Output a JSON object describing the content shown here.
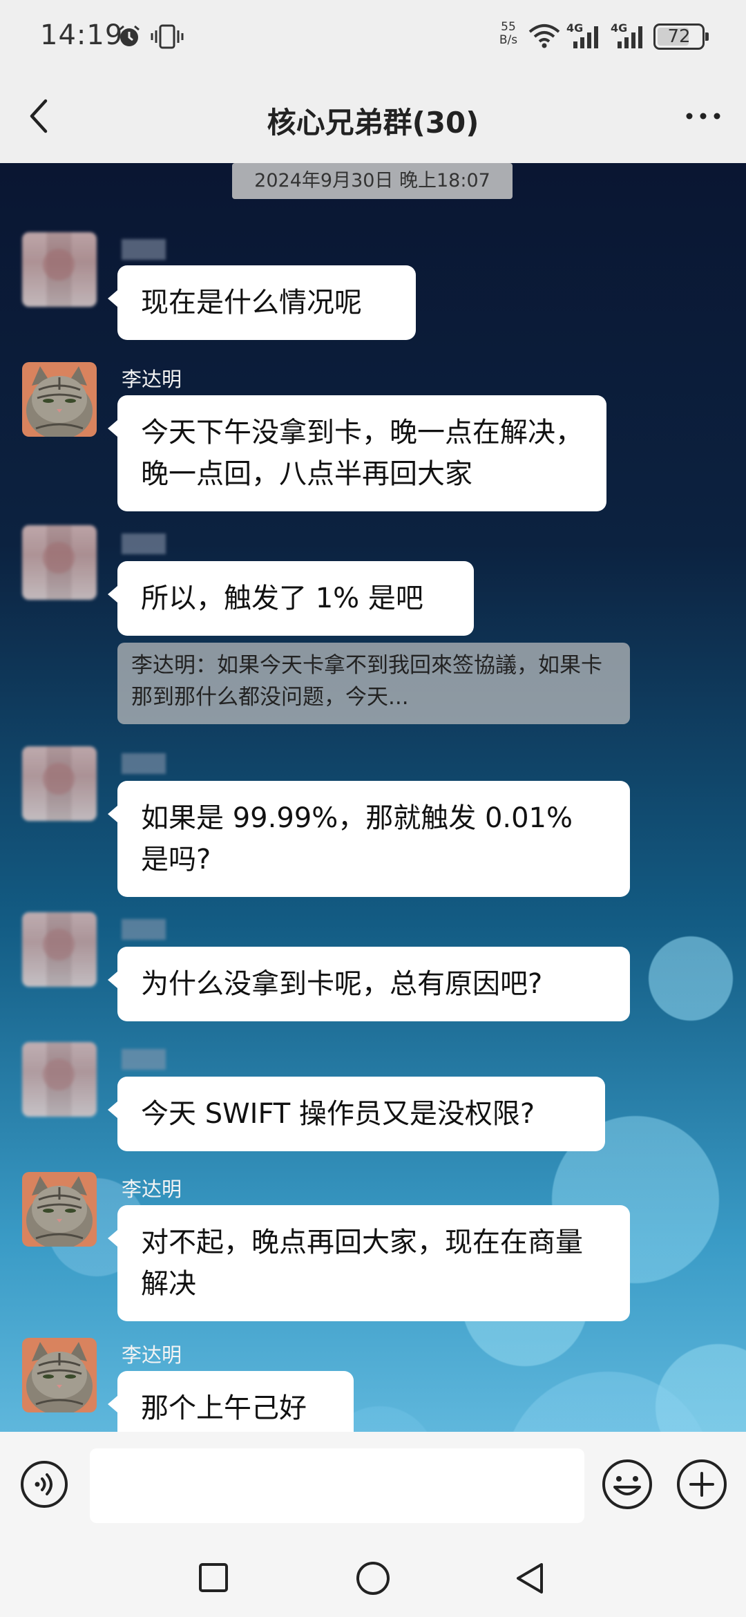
{
  "status_bar": {
    "time": "14:19",
    "net_speed_value": "55",
    "net_speed_unit": "B/s",
    "signal1_label": "4G",
    "signal2_label": "4G",
    "battery": "72",
    "battery_level": 0.72
  },
  "header": {
    "title": "核心兄弟群(30)"
  },
  "chat": {
    "timestamp": "2024年9月30日 晚上18:07",
    "messages": [
      {
        "sender": "",
        "text": "现在是什么情况呢"
      },
      {
        "sender": "李达明",
        "text": "今天下午没拿到卡，晚一点在解决，晚一点回，八点半再回大家"
      },
      {
        "sender": "",
        "text": "所以，触发了 1% 是吧",
        "quote": "李达明：如果今天卡拿不到我回來签協議，如果卡那到那什么都没问题，今天..."
      },
      {
        "sender": "",
        "text": "如果是 99.99%，那就触发 0.01% 是吗?"
      },
      {
        "sender": "",
        "text": "为什么没拿到卡呢，总有原因吧?"
      },
      {
        "sender": "",
        "text": "今天 SWIFT 操作员又是没权限?"
      },
      {
        "sender": "李达明",
        "text": "对不起，晚点再回大家，现在在商量解决"
      },
      {
        "sender": "李达明",
        "text": "那个上午己好"
      }
    ]
  },
  "input": {
    "value": "",
    "placeholder": ""
  },
  "icons": {
    "back": "chevron-left-icon",
    "more": "more-dots-icon",
    "voice": "voice-icon",
    "emoji": "emoji-icon",
    "plus": "plus-icon"
  },
  "colors": {
    "bubble": "#ffffff",
    "header_bg": "#efefef",
    "chat_bg_top": "#0a1632",
    "chat_bg_bottom": "#5fb7dc"
  }
}
